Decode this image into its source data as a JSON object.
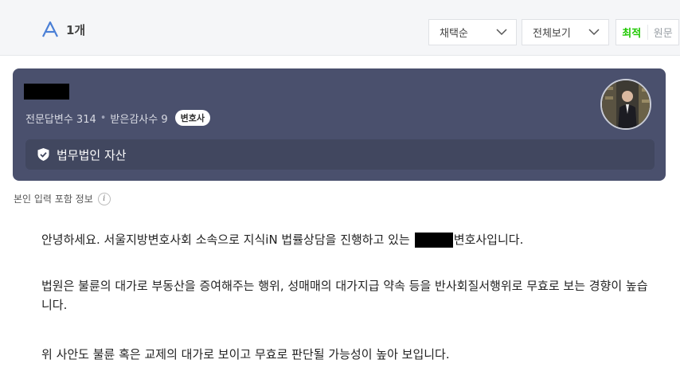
{
  "header": {
    "answer_count": "1개",
    "sort_select": "채택순",
    "filter_select": "전체보기",
    "toggle_on": "최적",
    "toggle_off": "원문"
  },
  "profile": {
    "stats_answers": "전문답변수 314",
    "stats_thanks": "받은감사수 9",
    "badge": "변호사",
    "firm": "법무법인 자산"
  },
  "info_label": "본인 입력 포함 정보",
  "body": {
    "p1_before": "안녕하세요. 서울지방변호사회 소속으로 지식iN 법률상담을 진행하고 있는",
    "p1_after": "변호사입니다.",
    "p2": "법원은 불륜의 대가로 부동산을 증여해주는 행위, 성매매의 대가지급 약속 등을 반사회질서행위로 무효로 보는 경향이 높습니다.",
    "p3": "위 사안도 불륜 혹은 교제의 대가로 보이고 무효로 판단될 가능성이 높아 보입니다."
  },
  "colors": {
    "card_bg": "#4a506d",
    "accent_green": "#1ec800",
    "answer_icon": "#4a7fd6"
  },
  "icons": [
    "answer-a-icon",
    "chevron-down-icon",
    "shield-check-icon",
    "info-icon"
  ]
}
